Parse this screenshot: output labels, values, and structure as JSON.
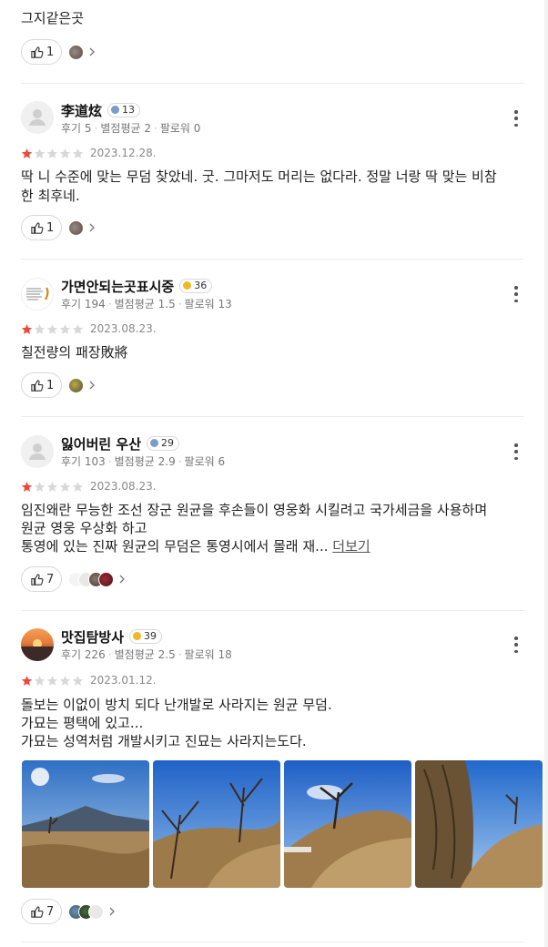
{
  "top_review": {
    "text": "그지같은곳",
    "likes": "1"
  },
  "reviews": [
    {
      "name": "李道炫",
      "level": "13",
      "level_color": "#7a9cc6",
      "meta": {
        "reviews": "후기 5",
        "avg": "별점평균 2",
        "followers": "팔로워 0"
      },
      "date": "2023.12.28.",
      "lines": [
        "딱 니 수준에 맞는 무덤 찾았네. 굿. 그마저도 머리는 없다라. 정말 너랑 딱 맞는 비참",
        "한 최후네."
      ],
      "likes": "1"
    },
    {
      "name": "가면안되는곳표시중",
      "level": "36",
      "level_color": "#f2b824",
      "meta": {
        "reviews": "후기 194",
        "avg": "별점평균 1.5",
        "followers": "팔로워 13"
      },
      "date": "2023.08.23.",
      "lines": [
        "칠전량의 패장敗將"
      ],
      "likes": "1"
    },
    {
      "name": "잃어버린 우산",
      "level": "29",
      "level_color": "#7a9cc6",
      "meta": {
        "reviews": "후기 103",
        "avg": "별점평균 2.9",
        "followers": "팔로워 6"
      },
      "date": "2023.08.23.",
      "lines": [
        "임진왜란 무능한 조선 장군 원균을 후손들이 영웅화 시킬려고 국가세금을 사용하며",
        "원균 영웅 우상화 하고",
        "통영에 있는 진짜 원균의 무덤은 통영시에서 몰래 재..."
      ],
      "more_label": "더보기",
      "likes": "7"
    },
    {
      "name": "맛집탐방사",
      "level": "39",
      "level_color": "#f2b824",
      "meta": {
        "reviews": "후기 226",
        "avg": "별점평균 2.5",
        "followers": "팔로워 18"
      },
      "date": "2023.01.12.",
      "lines": [
        "돌보는 이없이 방치 되다 난개발로 사라지는 원균 무덤.",
        "가묘는 평택에 있고...",
        "가묘는 성역처럼 개발시키고 진묘는 사라지는도다."
      ],
      "likes": "7"
    }
  ],
  "colors": {
    "star_on": "#f2463c",
    "star_off": "#d8d8d8"
  }
}
